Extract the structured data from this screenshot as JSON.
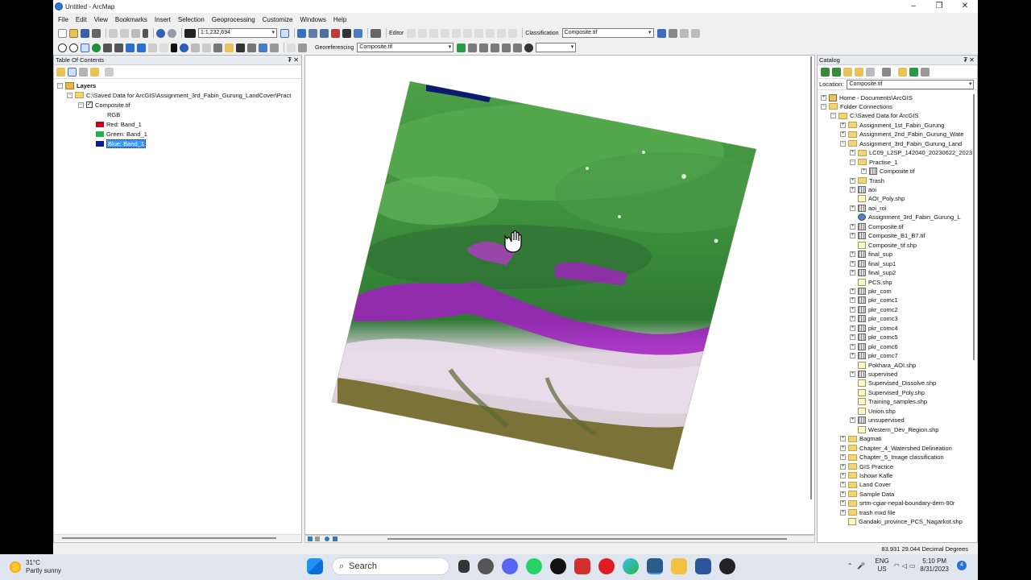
{
  "window": {
    "title": "Untitled - ArcMap",
    "minimize": "–",
    "maximize": "❐",
    "close": "✕"
  },
  "menu": [
    "File",
    "Edit",
    "View",
    "Bookmarks",
    "Insert",
    "Selection",
    "Geoprocessing",
    "Customize",
    "Windows",
    "Help"
  ],
  "toolbar": {
    "scale": "1:1,232,694",
    "editor": "Editor",
    "classification": "Classification",
    "classification_layer": "Composite.tif",
    "georeferencing": "Georeferencing",
    "georef_layer": "Composite.tif"
  },
  "toc": {
    "title": "Table Of Contents",
    "pin": "₮ ✕",
    "layers_label": "Layers",
    "source_path": "C:\\Saved Data for ArcGIS\\Assignment_3rd_Fabin_Gurung_LandCover\\Pract",
    "layer_name": "Composite.tif",
    "renderer": "RGB",
    "bands": [
      {
        "label": "Red:   Band_1",
        "color": "#c8001e"
      },
      {
        "label": "Green:  Band_1",
        "color": "#22b14c"
      },
      {
        "label": "Blue:  Band_1",
        "color": "#0a1aa0"
      }
    ]
  },
  "catalog": {
    "title": "Catalog",
    "pin": "₮ ✕",
    "location_label": "Location:",
    "location_value": "Composite.tif",
    "items": [
      {
        "label": "Home - Documents\\ArcGIS",
        "type": "home",
        "level": 0,
        "exp": "+"
      },
      {
        "label": "Folder Connections",
        "type": "folder",
        "level": 0,
        "exp": "−"
      },
      {
        "label": "C:\\Saved Data for ArcGIS",
        "type": "folder",
        "level": 1,
        "exp": "−"
      },
      {
        "label": "Assignment_1st_Fabin_Gurung",
        "type": "folder",
        "level": 2,
        "exp": "+"
      },
      {
        "label": "Assignment_2nd_Fabin_Gurung_Wate",
        "type": "folder",
        "level": 2,
        "exp": "+"
      },
      {
        "label": "Assignment_3rd_Fabin_Gurung_Land",
        "type": "folder",
        "level": 2,
        "exp": "−"
      },
      {
        "label": "LC09_L2SP_142040_20230622_2023",
        "type": "folder",
        "level": 3,
        "exp": "+"
      },
      {
        "label": "Practise_1",
        "type": "folder",
        "level": 3,
        "exp": "−"
      },
      {
        "label": "Composite.tif",
        "type": "raster",
        "level": 4,
        "exp": "+"
      },
      {
        "label": "Trash",
        "type": "folder",
        "level": 3,
        "exp": "+"
      },
      {
        "label": "aoi",
        "type": "raster",
        "level": 3,
        "exp": "+"
      },
      {
        "label": "AOI_Poly.shp",
        "type": "vector",
        "level": 3,
        "exp": ""
      },
      {
        "label": "aoi_roi",
        "type": "raster",
        "level": 3,
        "exp": "+"
      },
      {
        "label": "Assignment_3rd_Fabin_Gurung_L",
        "type": "toolbox",
        "level": 3,
        "exp": ""
      },
      {
        "label": "Composite.tif",
        "type": "raster",
        "level": 3,
        "exp": "+"
      },
      {
        "label": "Composite_B1_B7.tif",
        "type": "raster",
        "level": 3,
        "exp": "+"
      },
      {
        "label": "Composite_tif.shp",
        "type": "vector",
        "level": 3,
        "exp": ""
      },
      {
        "label": "final_sup",
        "type": "raster",
        "level": 3,
        "exp": "+"
      },
      {
        "label": "final_sup1",
        "type": "raster",
        "level": 3,
        "exp": "+"
      },
      {
        "label": "final_sup2",
        "type": "raster",
        "level": 3,
        "exp": "+"
      },
      {
        "label": "PCS.shp",
        "type": "vector",
        "level": 3,
        "exp": ""
      },
      {
        "label": "pkr_com",
        "type": "raster",
        "level": 3,
        "exp": "+"
      },
      {
        "label": "pkr_comc1",
        "type": "raster",
        "level": 3,
        "exp": "+"
      },
      {
        "label": "pkr_comc2",
        "type": "raster",
        "level": 3,
        "exp": "+"
      },
      {
        "label": "pkr_comc3",
        "type": "raster",
        "level": 3,
        "exp": "+"
      },
      {
        "label": "pkr_comc4",
        "type": "raster",
        "level": 3,
        "exp": "+"
      },
      {
        "label": "pkr_comc5",
        "type": "raster",
        "level": 3,
        "exp": "+"
      },
      {
        "label": "pkr_comc6",
        "type": "raster",
        "level": 3,
        "exp": "+"
      },
      {
        "label": "pkr_comc7",
        "type": "raster",
        "level": 3,
        "exp": "+"
      },
      {
        "label": "Pokhara_AOI.shp",
        "type": "vector",
        "level": 3,
        "exp": ""
      },
      {
        "label": "supervised",
        "type": "raster",
        "level": 3,
        "exp": "+"
      },
      {
        "label": "Supervised_Dissolve.shp",
        "type": "vector",
        "level": 3,
        "exp": ""
      },
      {
        "label": "Supervised_Poly.shp",
        "type": "vector",
        "level": 3,
        "exp": ""
      },
      {
        "label": "Training_samples.shp",
        "type": "vector",
        "level": 3,
        "exp": ""
      },
      {
        "label": "Union.shp",
        "type": "vector",
        "level": 3,
        "exp": ""
      },
      {
        "label": "unsupervised",
        "type": "raster",
        "level": 3,
        "exp": "+"
      },
      {
        "label": "Western_Dev_Region.shp",
        "type": "vector",
        "level": 3,
        "exp": ""
      },
      {
        "label": "Bagmati",
        "type": "folder",
        "level": 2,
        "exp": "+"
      },
      {
        "label": "Chapter_4_Watershed Delineation",
        "type": "folder",
        "level": 2,
        "exp": "+"
      },
      {
        "label": "Chapter_5_Image classification",
        "type": "folder",
        "level": 2,
        "exp": "+"
      },
      {
        "label": "GIS Practice",
        "type": "folder",
        "level": 2,
        "exp": "+"
      },
      {
        "label": "Ishowr Kafle",
        "type": "folder",
        "level": 2,
        "exp": "+"
      },
      {
        "label": "Land Cover",
        "type": "folder",
        "level": 2,
        "exp": "+"
      },
      {
        "label": "Sample Data",
        "type": "folder",
        "level": 2,
        "exp": "+"
      },
      {
        "label": "srtm-cgiar-nepal-boundary-dem-90r",
        "type": "folder",
        "level": 2,
        "exp": "+"
      },
      {
        "label": "trash mxd file",
        "type": "folder",
        "level": 2,
        "exp": "+"
      },
      {
        "label": "Gandaki_province_PCS_Nagarkot.shp",
        "type": "vector",
        "level": 2,
        "exp": ""
      }
    ]
  },
  "status": {
    "coordinates": "83.931  29.044 Decimal Degrees"
  },
  "taskbar": {
    "temperature": "31°C",
    "weather": "Partly sunny",
    "search_placeholder": "Search",
    "lang_top": "ENG",
    "lang_bottom": "US",
    "time": "5:10 PM",
    "date": "8/31/2023",
    "notification_count": "4"
  },
  "colors": {
    "vegetation": "#3f9a3a",
    "snow_purple": "#a21fc2",
    "snow_white": "#efe2ef",
    "terai_brown": "#7d7439"
  }
}
